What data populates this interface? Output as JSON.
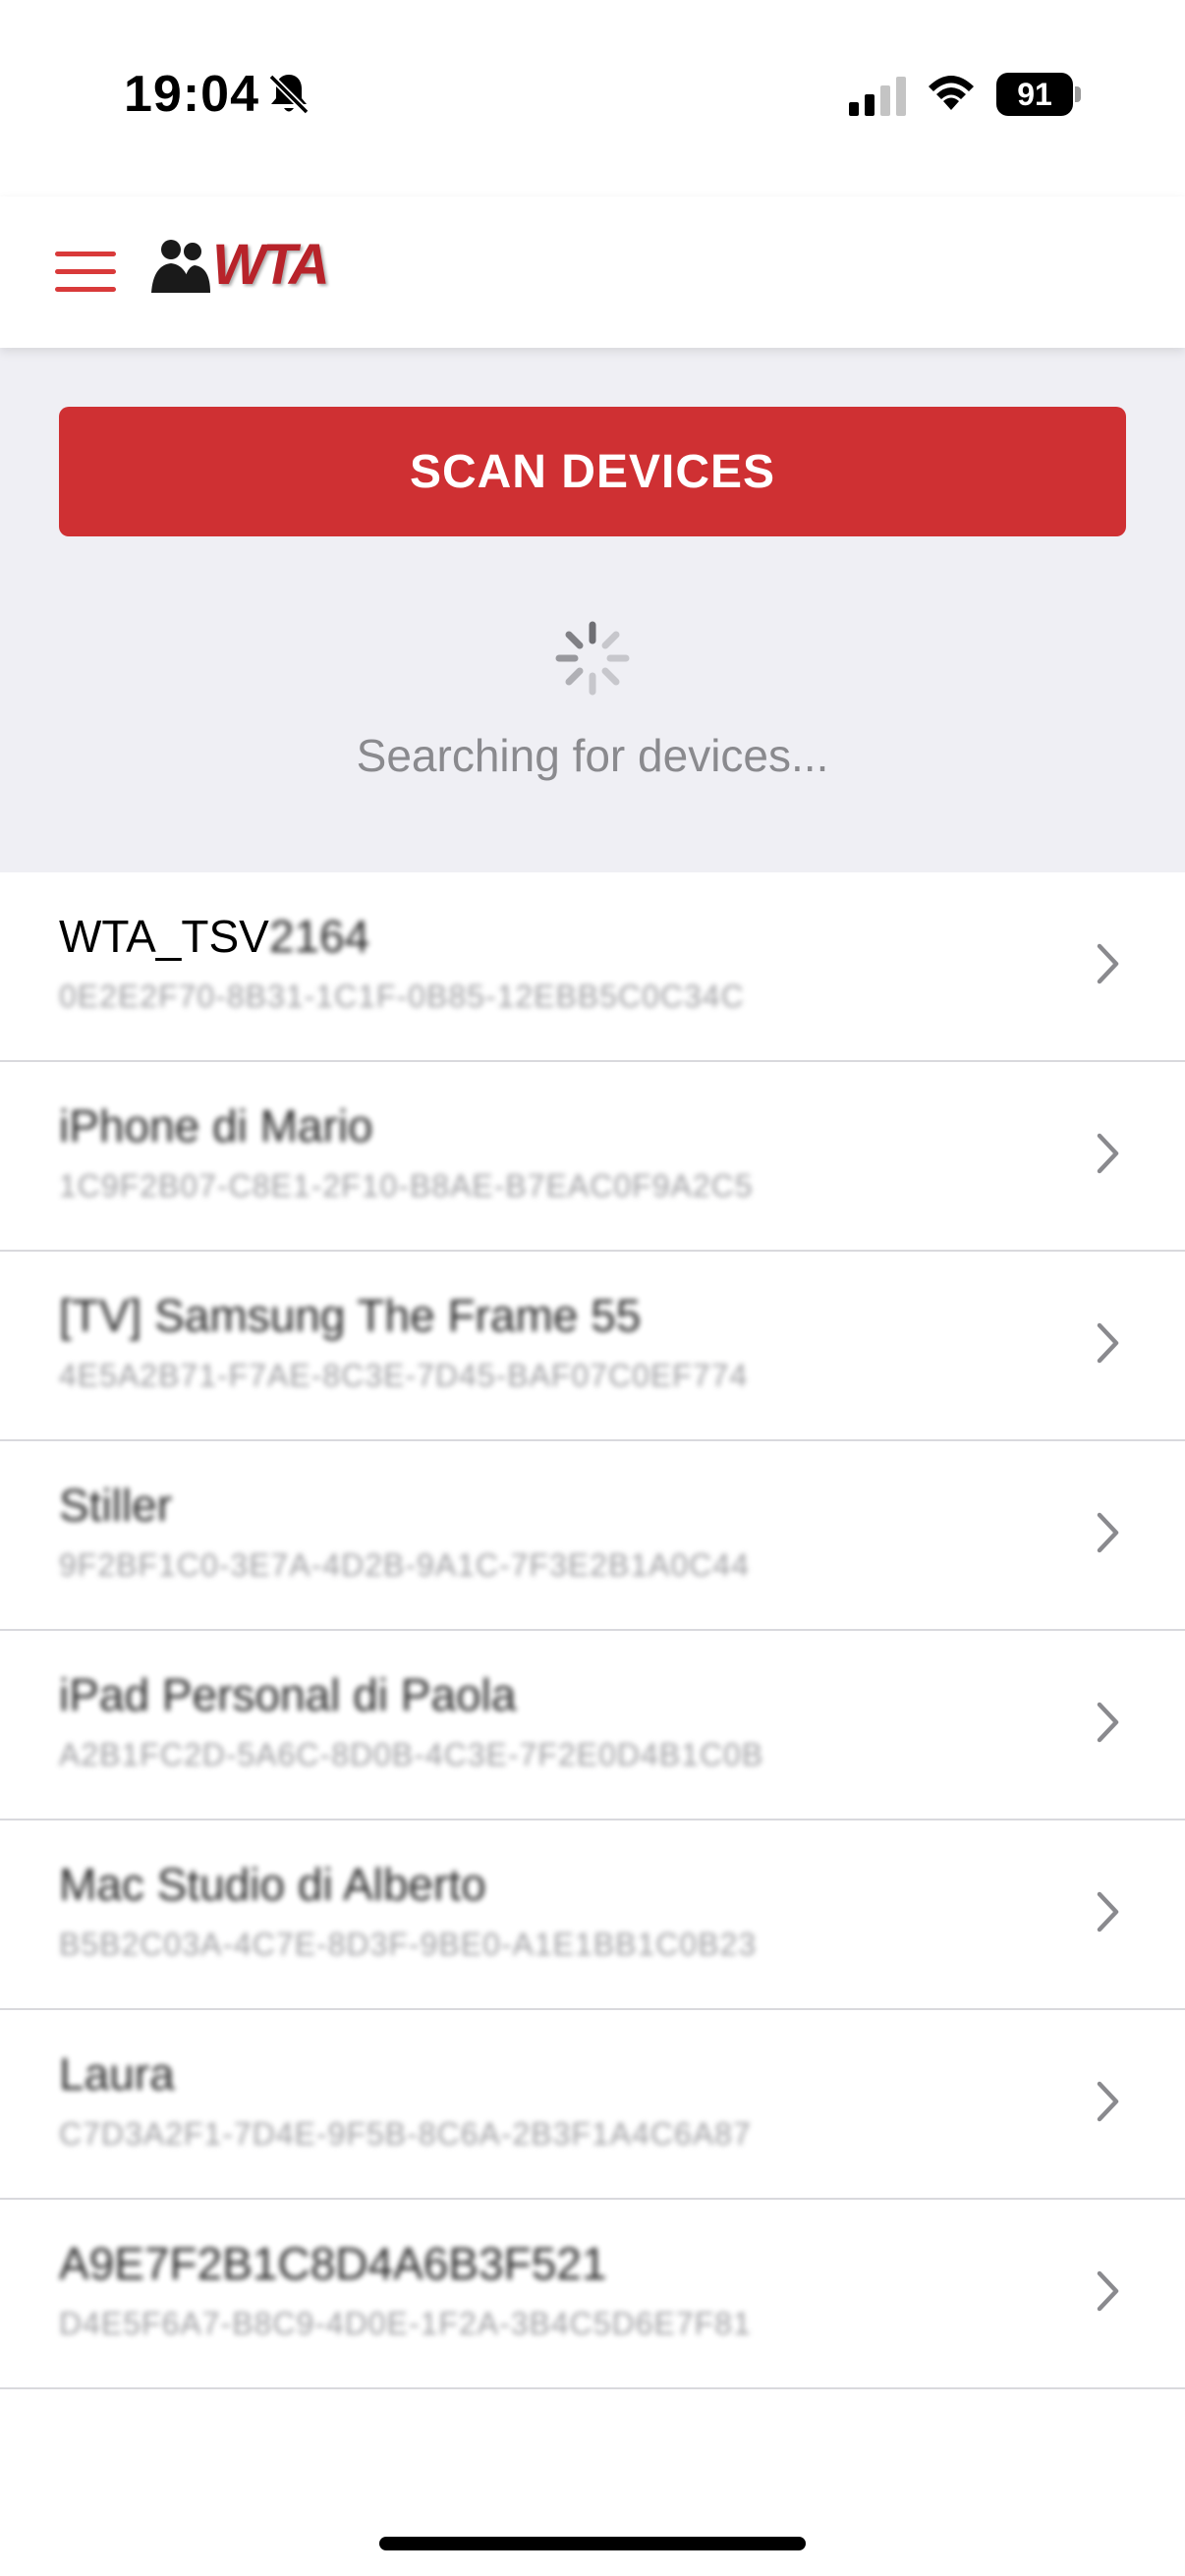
{
  "status_bar": {
    "time": "19:04",
    "battery": "91"
  },
  "header": {
    "logo_text": "WTA"
  },
  "scan": {
    "button_label": "SCAN DEVICES",
    "status_text": "Searching for devices..."
  },
  "devices": [
    {
      "name": "WTA_TSV",
      "name_hidden": "2164",
      "id": "0E2E2F70-8B31-1C1F-0B85-12EBB5C0C34C"
    },
    {
      "name": "",
      "name_hidden": "iPhone di Mario",
      "id": "1C9F2B07-C8E1-2F10-B8AE-B7EAC0F9A2C5"
    },
    {
      "name": "",
      "name_hidden": "[TV] Samsung The Frame 55",
      "id": "4E5A2B71-F7AE-8C3E-7D45-BAF07C0EF774"
    },
    {
      "name": "",
      "name_hidden": "Stiller",
      "id": "9F2BF1C0-3E7A-4D2B-9A1C-7F3E2B1A0C44"
    },
    {
      "name": "",
      "name_hidden": "iPad Personal di Paola",
      "id": "A2B1FC2D-5A6C-8D0B-4C3E-7F2E0D4B1C0B"
    },
    {
      "name": "",
      "name_hidden": "Mac Studio di Alberto",
      "id": "B5B2C03A-4C7E-8D3F-9BE0-A1E1BB1C0B23"
    },
    {
      "name": "",
      "name_hidden": "Laura",
      "id": "C7D3A2F1-7D4E-9F5B-8C6A-2B3F1A4C6A87"
    },
    {
      "name": "",
      "name_hidden": "A9E7F2B1C8D4A6B3F521",
      "id": "D4E5F6A7-B8C9-4D0E-1F2A-3B4C5D6E7F81"
    }
  ],
  "icons": {
    "menu": "hamburger-icon",
    "bell_off": "bell-slash-icon",
    "signal": "cellular-signal-icon",
    "wifi": "wifi-icon",
    "spinner": "activity-spinner-icon",
    "chevron": "chevron-right-icon"
  },
  "colors": {
    "accent": "#cf3033",
    "logo": "#b8232a",
    "background_scan": "#efeff4",
    "secondary_text": "#8a8a8e"
  }
}
